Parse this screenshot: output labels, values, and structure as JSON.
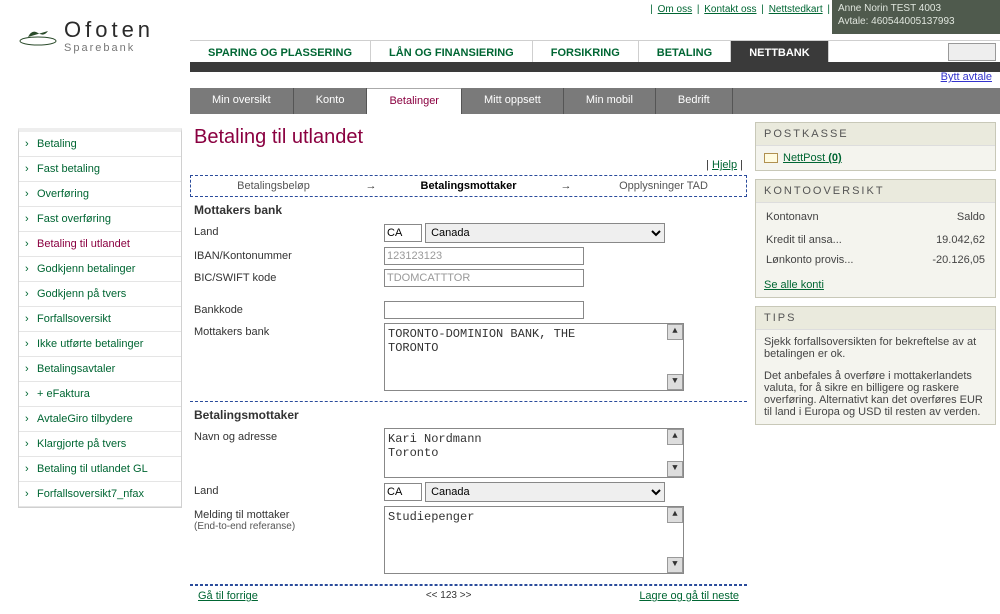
{
  "toplinks": {
    "om": "Om oss",
    "kontakt": "Kontakt oss",
    "kart": "Nettstedkart"
  },
  "avtale": {
    "name": "Anne Norin TEST 4003",
    "label": "Avtale:",
    "number": "460544005137993"
  },
  "logo": {
    "main": "Ofoten",
    "sub": "Sparebank"
  },
  "bytt_avtale": "Bytt avtale",
  "maintabs": {
    "sparing": "SPARING OG PLASSERING",
    "laan": "LÅN OG FINANSIERING",
    "forsikring": "FORSIKRING",
    "betaling": "BETALING",
    "nettbank": "NETTBANK"
  },
  "subtabs": {
    "oversikt": "Min oversikt",
    "konto": "Konto",
    "betalinger": "Betalinger",
    "oppsett": "Mitt oppsett",
    "mobil": "Min mobil",
    "bedrift": "Bedrift"
  },
  "leftmenu": {
    "betaling": "Betaling",
    "fast_betaling": "Fast betaling",
    "overforing": "Overføring",
    "fast_overforing": "Fast overføring",
    "betaling_utlandet": "Betaling til utlandet",
    "godkjenn_bet": "Godkjenn betalinger",
    "godkjenn_tvers": "Godkjenn på tvers",
    "forfall": "Forfallsoversikt",
    "ikke_utforte": "Ikke utførte betalinger",
    "betalingsavtaler": "Betalingsavtaler",
    "efaktura": "+ eFaktura",
    "avtalegiro": "AvtaleGiro tilbydere",
    "klargjorte": "Klargjorte på tvers",
    "betaling_utlandet_gl": "Betaling til utlandet GL",
    "forfall7": "Forfallsoversikt7_nfax"
  },
  "page_title": "Betaling til utlandet",
  "hjelp": "Hjelp",
  "wizard": {
    "step1": "Betalingsbeløp",
    "step2": "Betalingsmottaker",
    "step3": "Opplysninger TAD"
  },
  "form": {
    "section1_title": "Mottakers bank",
    "land_label": "Land",
    "land_code": "CA",
    "land_name": "Canada",
    "iban_label": "IBAN/Kontonummer",
    "iban_value": "123123123",
    "bic_label": "BIC/SWIFT kode",
    "bic_value": "TDOMCATTTOR",
    "bankkode_label": "Bankkode",
    "bankkode_value": "",
    "mottakersbank_label": "Mottakers bank",
    "mottakersbank_value": "TORONTO-DOMINION BANK, THE\nTORONTO",
    "section2_title": "Betalingsmottaker",
    "navn_label": "Navn og adresse",
    "navn_value": "Kari Nordmann\nToronto",
    "land2_label": "Land",
    "land2_code": "CA",
    "land2_name": "Canada",
    "melding_label": "Melding til mottaker",
    "melding_sub": "(End-to-end referanse)",
    "melding_value": "Studiepenger"
  },
  "footer": {
    "forrige": "Gå til forrige",
    "pager": "<< 123 >>",
    "neste": "Lagre og gå til neste"
  },
  "postkasse": {
    "title": "POSTKASSE",
    "link": "NettPost",
    "count": "(0)"
  },
  "kontooversikt": {
    "title": "KONTOOVERSIKT",
    "col1": "Kontonavn",
    "col2": "Saldo",
    "rows": [
      {
        "name": "Kredit til ansa...",
        "saldo": "19.042,62"
      },
      {
        "name": "Lønkonto provis...",
        "saldo": "-20.126,05"
      }
    ],
    "sealle": "Se alle konti"
  },
  "tips": {
    "title": "TIPS",
    "p1": "Sjekk forfallsoversikten for bekreftelse av at betalingen er ok.",
    "p2": "Det anbefales å overføre i mottakerlandets valuta, for å sikre en billigere og raskere overføring. Alternativt kan det overføres EUR til land i Europa og USD til resten av verden."
  }
}
